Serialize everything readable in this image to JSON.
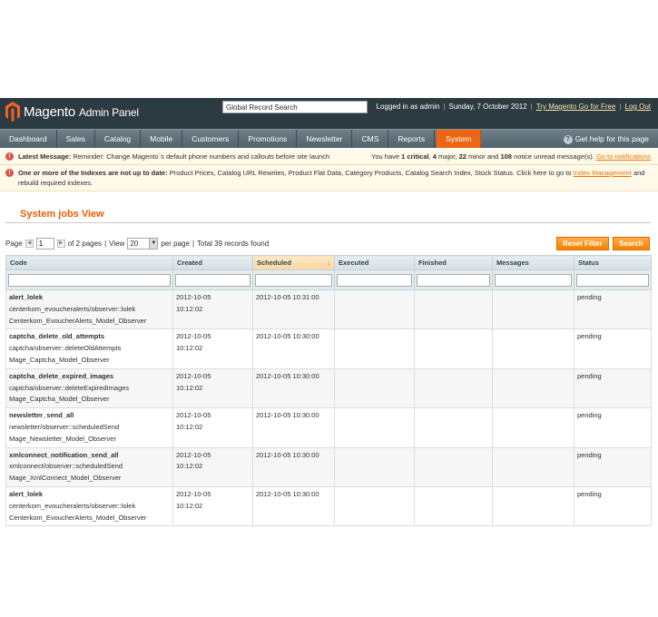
{
  "header": {
    "logo_text": "Magento",
    "logo_sub": "Admin Panel",
    "global_search_value": "Global Record Search",
    "logged_in": "Logged in as admin",
    "date": "Sunday, 7 October 2012",
    "try_go": "Try Magento Go for Free",
    "logout": "Log Out"
  },
  "nav": {
    "items": [
      "Dashboard",
      "Sales",
      "Catalog",
      "Mobile",
      "Customers",
      "Promotions",
      "Newsletter",
      "CMS",
      "Reports",
      "System"
    ],
    "active": "System",
    "help": "Get help for this page"
  },
  "messages": {
    "latest_label": "Latest Message:",
    "latest_text": "Reminder: Change Magento`s default phone numbers and callouts before site launch",
    "you_have": "You have",
    "critical": "1 critical",
    "major_pre": ",",
    "major": "4",
    "major_label": "major,",
    "minor": "22",
    "minor_label": "minor and",
    "notice": "108",
    "notice_label": "notice unread message(s).",
    "goto": "Go to notifications",
    "index_label": "One or more of the Indexes are not up to date:",
    "index_text": "Product Prices, Catalog URL Rewrites, Product Flat Data, Category Products, Catalog Search Index, Stock Status. Click here to go to",
    "index_link": "Index Management",
    "index_tail": "and rebuild required indexes."
  },
  "page": {
    "title": "System jobs View"
  },
  "pager": {
    "page_label": "Page",
    "page_value": "1",
    "of_pages": "of 2 pages",
    "sep": "|",
    "view_label": "View",
    "per_page_value": "20",
    "per_page_label": "per page",
    "sep2": "|",
    "total": "Total 39 records found"
  },
  "buttons": {
    "reset": "Reset Filter",
    "search": "Search"
  },
  "grid": {
    "columns": [
      "Code",
      "Created",
      "Scheduled",
      "Executed",
      "Finished",
      "Messages",
      "Status"
    ],
    "sorted_column": "Scheduled",
    "sort_indicator": "↓",
    "rows": [
      {
        "name": "alert_lolek",
        "path": "centerkom_evoucheralerts/observer::lolek",
        "model": "Centerkom_EvoucherAlerts_Model_Observer",
        "created_date": "2012-10-05",
        "created_time": "10:12:02",
        "scheduled": "2012-10-05 10:31:00",
        "executed": "",
        "finished": "",
        "messages": "",
        "status": "pending"
      },
      {
        "name": "captcha_delete_old_attempts",
        "path": "captcha/observer::deleteOldAttempts",
        "model": "Mage_Captcha_Model_Observer",
        "created_date": "2012-10-05",
        "created_time": "10:12:02",
        "scheduled": "2012-10-05 10:30:00",
        "executed": "",
        "finished": "",
        "messages": "",
        "status": "pending"
      },
      {
        "name": "captcha_delete_expired_images",
        "path": "captcha/observer::deleteExpiredImages",
        "model": "Mage_Captcha_Model_Observer",
        "created_date": "2012-10-05",
        "created_time": "10:12:02",
        "scheduled": "2012-10-05 10:30:00",
        "executed": "",
        "finished": "",
        "messages": "",
        "status": "pending"
      },
      {
        "name": "newsletter_send_all",
        "path": "newsletter/observer::scheduledSend",
        "model": "Mage_Newsletter_Model_Observer",
        "created_date": "2012-10-05",
        "created_time": "10:12:02",
        "scheduled": "2012-10-05 10:30:00",
        "executed": "",
        "finished": "",
        "messages": "",
        "status": "pending"
      },
      {
        "name": "xmlconnect_notification_send_all",
        "path": "xmlconnect/observer::scheduledSend",
        "model": "Mage_XmlConnect_Model_Observer",
        "created_date": "2012-10-05",
        "created_time": "10:12:02",
        "scheduled": "2012-10-05 10:30:00",
        "executed": "",
        "finished": "",
        "messages": "",
        "status": "pending"
      },
      {
        "name": "alert_lolek",
        "path": "centerkom_evoucheralerts/observer::lolek",
        "model": "Centerkom_EvoucherAlerts_Model_Observer",
        "created_date": "2012-10-05",
        "created_time": "10:12:02",
        "scheduled": "2012-10-05 10:30:00",
        "executed": "",
        "finished": "",
        "messages": "",
        "status": "pending"
      }
    ]
  }
}
